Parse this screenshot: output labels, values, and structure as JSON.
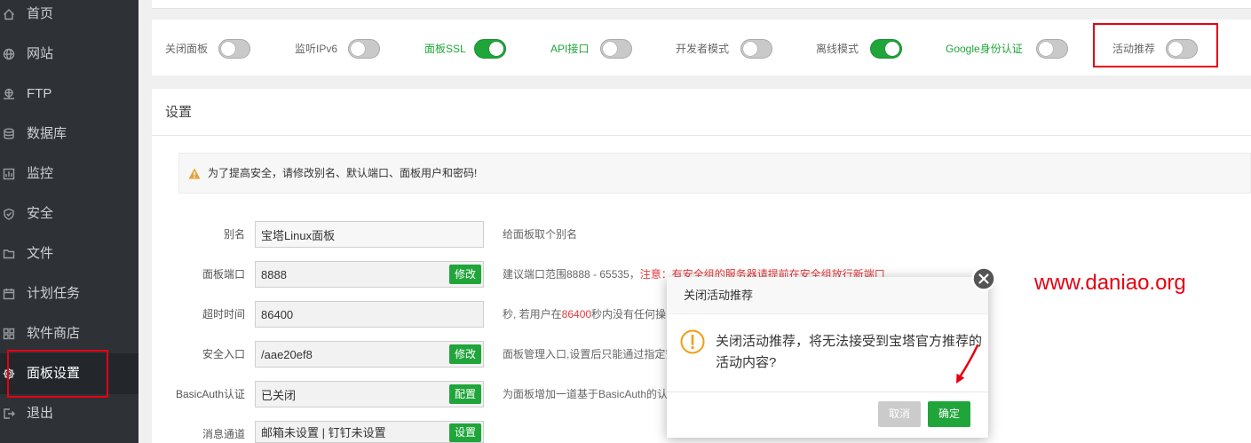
{
  "sidebar": {
    "items": [
      {
        "label": "首页",
        "icon": "home-icon"
      },
      {
        "label": "网站",
        "icon": "globe-icon"
      },
      {
        "label": "FTP",
        "icon": "ftp-icon"
      },
      {
        "label": "数据库",
        "icon": "database-icon"
      },
      {
        "label": "监控",
        "icon": "monitor-icon"
      },
      {
        "label": "安全",
        "icon": "shield-icon"
      },
      {
        "label": "文件",
        "icon": "folder-icon"
      },
      {
        "label": "计划任务",
        "icon": "calendar-icon"
      },
      {
        "label": "软件商店",
        "icon": "grid-icon"
      },
      {
        "label": "面板设置",
        "icon": "gear-icon",
        "active": true
      },
      {
        "label": "退出",
        "icon": "logout-icon"
      }
    ]
  },
  "toggles": [
    {
      "label": "关闭面板",
      "on": false,
      "label_color": "#666666"
    },
    {
      "label": "监听IPv6",
      "on": false,
      "label_color": "#666666"
    },
    {
      "label": "面板SSL",
      "on": true,
      "label_color": "#20a53a"
    },
    {
      "label": "API接口",
      "on": false,
      "label_color": "#20a53a"
    },
    {
      "label": "开发者模式",
      "on": false,
      "label_color": "#666666"
    },
    {
      "label": "离线模式",
      "on": true,
      "label_color": "#666666"
    },
    {
      "label": "Google身份认证",
      "on": false,
      "label_color": "#20a53a"
    },
    {
      "label": "活动推荐",
      "on": false,
      "label_color": "#666666"
    }
  ],
  "settings": {
    "title": "设置",
    "warning": "为了提高安全，请修改别名、默认端口、面板用户和密码!",
    "rows": [
      {
        "label": "别名",
        "value": "宝塔Linux面板",
        "hint": [
          {
            "text": "给面板取个别名",
            "color": "#666666"
          }
        ]
      },
      {
        "label": "面板端口",
        "value": "8888",
        "button": "修改",
        "hint": [
          {
            "text": "建议端口范围8888 - 65535，",
            "color": "#666666"
          },
          {
            "text": "注意：有安全组的服务器请提前在安全组放行新端口",
            "color": "#e4393c"
          }
        ]
      },
      {
        "label": "超时时间",
        "value": "86400",
        "hint": [
          {
            "text": "秒, 若用户在",
            "color": "#666666"
          },
          {
            "text": "86400",
            "color": "#e4393c"
          },
          {
            "text": "秒内没有任何操",
            "color": "#666666"
          }
        ]
      },
      {
        "label": "安全入口",
        "value": "/aae20ef8",
        "button": "修改",
        "hint": [
          {
            "text": "面板管理入口,设置后只能通过指定安",
            "color": "#666666"
          }
        ]
      },
      {
        "label": "BasicAuth认证",
        "value": "已关闭",
        "button": "配置",
        "hint": [
          {
            "text": "为面板增加一道基于BasicAuth的认",
            "color": "#666666"
          }
        ]
      },
      {
        "label": "消息通道",
        "value": "邮箱未设置 | 钉钉未设置",
        "button": "设置"
      }
    ]
  },
  "modal": {
    "title": "关闭活动推荐",
    "message": "关闭活动推荐，将无法接受到宝塔官方推荐的活动内容?",
    "cancel_label": "取消",
    "confirm_label": "确定",
    "close_icon": "close-icon",
    "message_icon": "warning-icon"
  },
  "watermark": "www.daniao.org",
  "colors": {
    "accent": "#20a53a",
    "annotation_red": "#e60012",
    "warning_orange": "#f39c12",
    "sidebar_bg": "#2e3237"
  }
}
